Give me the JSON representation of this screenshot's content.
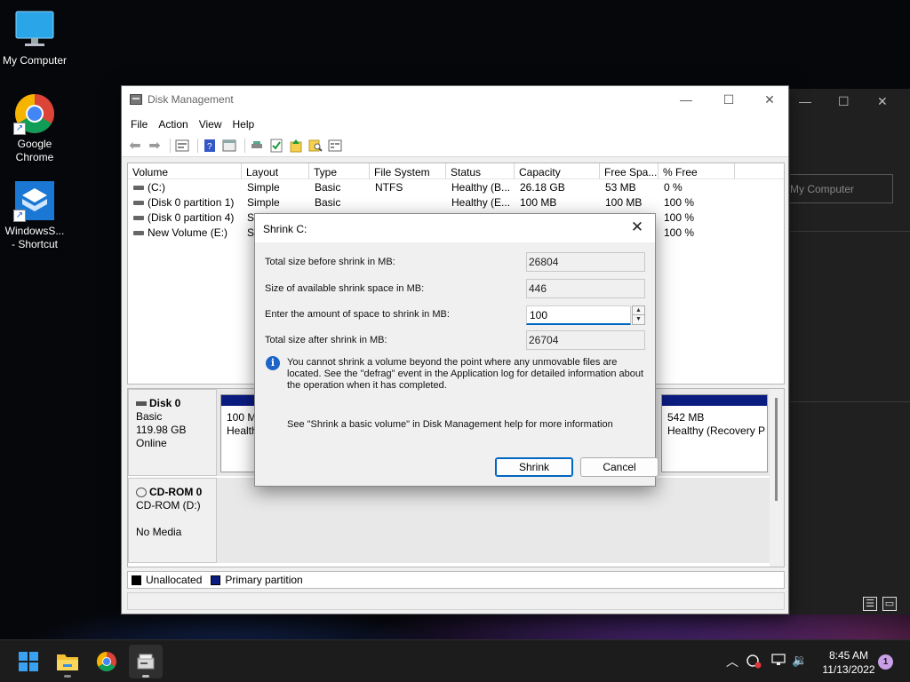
{
  "desktop": {
    "icons": [
      {
        "label": "My Computer"
      },
      {
        "label": "Google Chrome"
      },
      {
        "label": "WindowsS... - Shortcut"
      }
    ]
  },
  "background_window": {
    "address_text": "My Computer"
  },
  "window": {
    "title": "Disk Management",
    "menu": [
      "File",
      "Action",
      "View",
      "Help"
    ],
    "volume_columns": [
      "Volume",
      "Layout",
      "Type",
      "File System",
      "Status",
      "Capacity",
      "Free Spa...",
      "% Free"
    ],
    "volumes": [
      {
        "volume": "(C:)",
        "layout": "Simple",
        "type": "Basic",
        "fs": "NTFS",
        "status": "Healthy (B...",
        "capacity": "26.18 GB",
        "free": "53 MB",
        "pct": "0 %"
      },
      {
        "volume": "(Disk 0 partition 1)",
        "layout": "Simple",
        "type": "Basic",
        "fs": "",
        "status": "Healthy (E...",
        "capacity": "100 MB",
        "free": "100 MB",
        "pct": "100 %"
      },
      {
        "volume": "(Disk 0 partition 4)",
        "layout": "Si",
        "type": "",
        "fs": "",
        "status": "",
        "capacity": "",
        "free": "",
        "pct": "100 %"
      },
      {
        "volume": "New Volume (E:)",
        "layout": "Si",
        "type": "",
        "fs": "",
        "status": "",
        "capacity": "",
        "free": "",
        "pct": "100 %"
      }
    ],
    "disk0": {
      "name": "Disk 0",
      "type": "Basic",
      "size": "119.98 GB",
      "state": "Online",
      "partition_left_size": "100 M",
      "partition_left_status": "Health",
      "partition_right_size": "542 MB",
      "partition_right_status": "Healthy (Recovery P"
    },
    "cdrom0": {
      "name": "CD-ROM 0",
      "drive": "CD-ROM (D:)",
      "media": "No Media"
    },
    "legend": [
      {
        "label": "Unallocated",
        "color": "#000000"
      },
      {
        "label": "Primary partition",
        "color": "#0a1c80"
      }
    ]
  },
  "dialog": {
    "title": "Shrink C:",
    "total_before_label": "Total size before shrink in MB:",
    "total_before_value": "26804",
    "available_label": "Size of available shrink space in MB:",
    "available_value": "446",
    "amount_label": "Enter the amount of space to shrink in MB:",
    "amount_value": "100",
    "total_after_label": "Total size after shrink in MB:",
    "total_after_value": "26704",
    "info_text": "You cannot shrink a volume beyond the point where any unmovable files are located. See the \"defrag\" event in the Application log for detailed information about the operation when it has completed.",
    "help_text": "See \"Shrink a basic volume\" in Disk Management help for more information",
    "shrink_label": "Shrink",
    "cancel_label": "Cancel"
  },
  "taskbar": {
    "time": "8:45 AM",
    "date": "11/13/2022",
    "notification_count": "1"
  }
}
